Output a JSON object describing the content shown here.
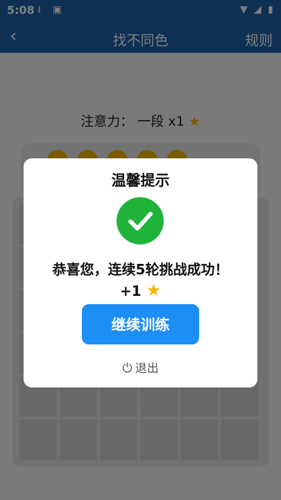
{
  "status_bar": {
    "time": "5:08"
  },
  "app_bar": {
    "back_icon": "chevron-left-icon",
    "title": "找不同色",
    "rules_label": "规则"
  },
  "attention": {
    "label": "注意力：",
    "level": "一段",
    "multiplier": "x1",
    "icon": "star-icon"
  },
  "progress": {
    "completed": 5,
    "total": 5
  },
  "dialog": {
    "title": "温馨提示",
    "icon": "check-circle-icon",
    "message": "恭喜您，连续5轮挑战成功！",
    "reward": "+1",
    "reward_icon": "star-icon",
    "continue_label": "继续训练",
    "exit_label": "退出",
    "exit_icon": "power-icon"
  },
  "colors": {
    "primary": "#1a60a6",
    "button": "#1d8ef5",
    "success": "#1fb33a",
    "star": "#f5b800"
  }
}
